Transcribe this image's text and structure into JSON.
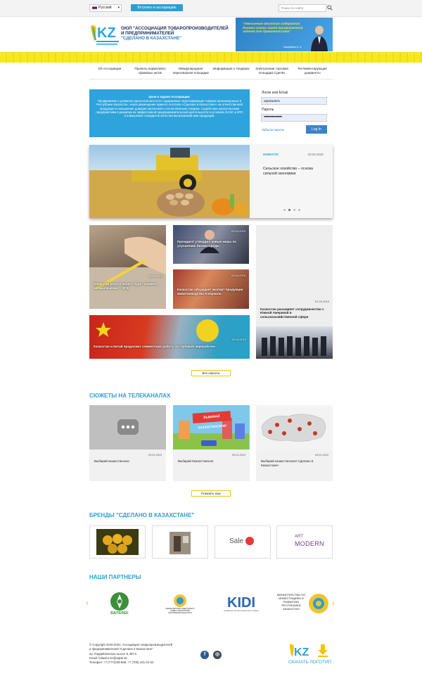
{
  "topbar": {
    "language": "Русский",
    "join_button": "Вступить в ассоциацию",
    "search_placeholder": "Поиск по сайту"
  },
  "header": {
    "org_line1": "ОЮЛ \"АССОЦИАЦИЯ ТОВАРОПРОИЗВОДИТЕЛЕЙ",
    "org_line2": "И ПРЕДПРИНИМАТЕЛЕЙ",
    "org_line3": "\"СДЕЛАНО В КАЗАХСТАНЕ\"",
    "banner_quote": "\"Увеличение местного содержания должно стать самой приоритетной задачей для Правительства\"",
    "banner_author": "Назарбаев Н. А."
  },
  "nav": [
    "Об Ассоциации",
    "Проекты нормативно правовых актов",
    "Международная переговорная площадка",
    "Информация о тендерах",
    "Электронная торговая площадка СделКз",
    "Регламентирующие документы"
  ],
  "info": {
    "heading": "Цели и задачи Ассоциации:",
    "body": "Продвижение и развитие идеологии местного содержания. Идентификация товаров произведенных в Республике Казахстан, через размещение единого логотипа «Сделано в Казахстане» на отечественной продукции и повышение доверия населения к отечественным товарам. Содействие казахстанским предприятиям в развитии их эффективной предпринимательской деятельности в условиях ЕАЭС и ВТО и повышение стандартов качества выпускаемой ими продукции."
  },
  "login": {
    "login_label": "Логин или Email",
    "login_value": "atpskadmin",
    "password_label": "Пароль",
    "password_value": "••••••••••••••••",
    "forgot": "Забыли пароль",
    "submit": "Log In"
  },
  "slider": {
    "category": "НОВОСТИ",
    "date": "03.04.2019",
    "title": "Сельское хозяйство – основа сильной экономики"
  },
  "news": [
    {
      "date": "31.01.2019",
      "title": "Пеню при уплате налога будут снимать автоматически — КГД"
    },
    {
      "date": "03.04.2019",
      "title": "Президент утвердил новые меры по улучшению бизнес-среды"
    },
    {
      "date": "03.04.2019",
      "title": "Казахстан обсуждает экспорт продукции животноводства в Израиль"
    },
    {
      "date": "01.04.2019",
      "title": "Казахстан расширяет сотрудничество с Южной Америкой в сельскохозяйственной сфере"
    },
    {
      "date": "03.04.2019",
      "title": "Казахстан и Китай продолжат совместную работу по глубокой переработке"
    }
  ],
  "all_news": "Все новости",
  "tv": {
    "heading": "СЮЖЕТЫ НА ТЕЛЕКАНАЛАХ",
    "items": [
      {
        "date": "09.01.2019",
        "title": "Выбирай казахстанское"
      },
      {
        "date": "09.01.2019",
        "title": "Выбирай Казахстанское"
      },
      {
        "date": "09.01.2019",
        "title": "Выбирай казахстанское! Сделано в Казахстане!"
      }
    ],
    "billboard": "ВЫБИРАЙ КАЗАХСТАНСКОЕ!",
    "more": "Показать еще"
  },
  "brands": {
    "heading": "БРЕНДЫ \"СДЕЛАНО В КАЗАХСТАНЕ\"",
    "sale_text": "Sale",
    "art_line1": "ART",
    "art_line2": "MODERN"
  },
  "partners": {
    "heading": "НАШИ ПАРТНЕРЫ",
    "baiterek": "BAITEREK",
    "ministry1": "МИНИСТЕРСТВО ИНДУСТРИИ И НОВЫХ ТЕХНОЛОГИЙ РЕСПУБЛИКИ КАЗАХСТАН",
    "kidi": "KIDI",
    "kidi_sub": "Kazakhstan Industry Development Institute",
    "ministry2": "МИНИСТЕРСТВО ПО ИНВЕСТИЦИЯМ И РАЗВИТИЮ РЕСПУБЛИКИ КАЗАХСТАН"
  },
  "footer": {
    "line1": "© Copyright 2016-2021, Ассоциация товаропроизводителей",
    "line2": "и предпринимателей \"Сделано в Казахстане\"",
    "line3": "пр. Кордайлинское шоссе 6, ВП 6",
    "line4": "Email: fotiasiro-kz@atpsk.kz",
    "line5": "Телефон: +7 (777)249-555, +7 (705) 421-24-32",
    "download": "СКАЧАТЬ ЛОГОТИП"
  },
  "colors": {
    "accent": "#2a9fd6",
    "stripe": "#f7e81e",
    "button": "#3a82c9"
  }
}
